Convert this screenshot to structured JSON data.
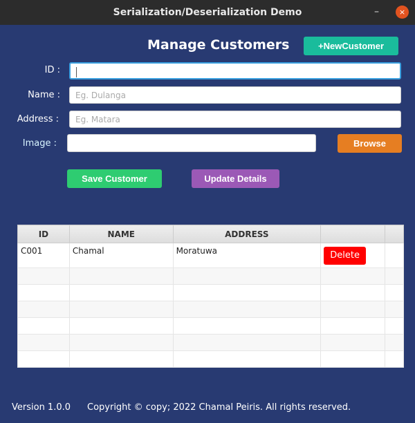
{
  "window": {
    "title": "Serialization/Deserialization Demo",
    "minimize": "–",
    "close": "×"
  },
  "header": {
    "title": "Manage Customers",
    "new_customer": "+NewCustomer"
  },
  "form": {
    "id": {
      "label": "ID :",
      "value": ""
    },
    "name": {
      "label": "Name :",
      "placeholder": "Eg. Dulanga"
    },
    "address": {
      "label": "Address :",
      "placeholder": "Eg. Matara"
    },
    "image": {
      "label": "Image :",
      "value": ""
    },
    "browse": "Browse",
    "save": "Save Customer",
    "update": "Update Details"
  },
  "table": {
    "headers": [
      "ID",
      "NAME",
      "ADDRESS",
      ""
    ],
    "rows": [
      {
        "id": "C001",
        "name": "Chamal",
        "address": "Moratuwa",
        "action": "Delete"
      }
    ]
  },
  "footer": {
    "version": "Version 1.0.0",
    "copyright": "Copyright © copy; 2022 Chamal Peiris. All rights reserved."
  },
  "colors": {
    "bg": "#283a72",
    "teal": "#1abc9c",
    "orange": "#e67e22",
    "green": "#2ecc71",
    "purple": "#9b59b6",
    "red": "#ff0000"
  }
}
